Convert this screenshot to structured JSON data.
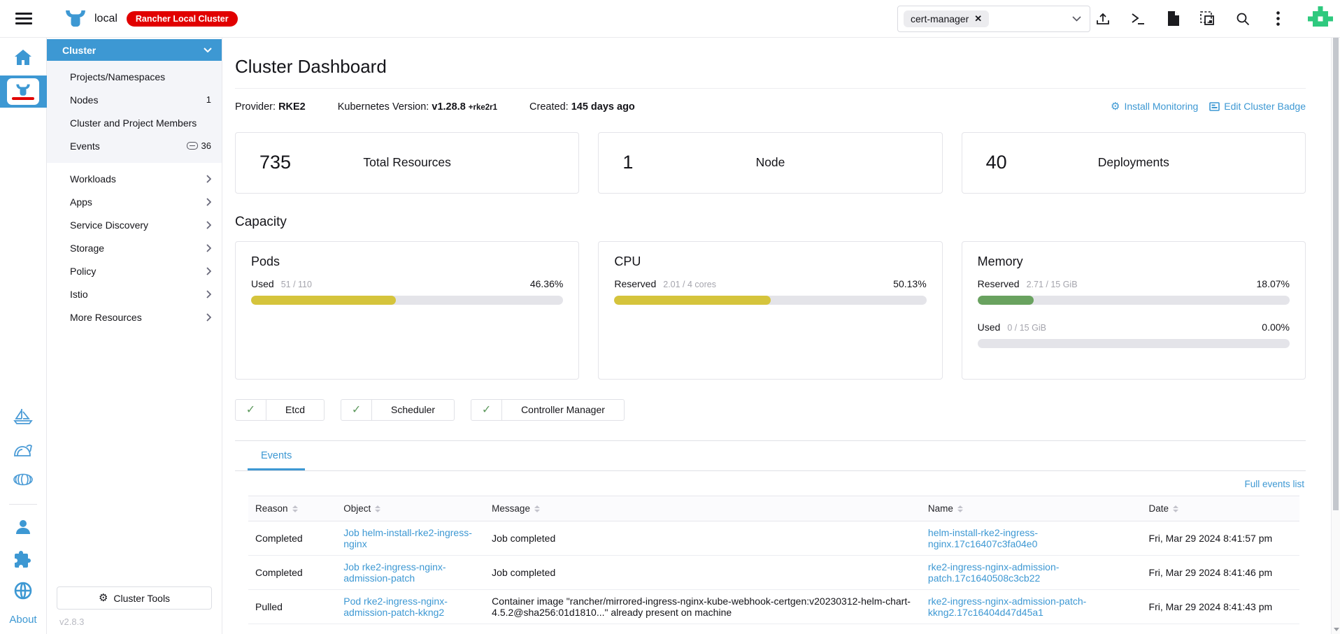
{
  "colors": {
    "primary": "#3d98d3",
    "badge_red": "#e10000",
    "bar_yellow": "#d5c43c",
    "bar_green": "#69a25f",
    "success_check": "#5d995d"
  },
  "topbar": {
    "cluster_name": "local",
    "cluster_badge": "Rancher Local Cluster",
    "namespace_filter": {
      "chip": "cert-manager",
      "remove_glyph": "✕"
    }
  },
  "rail": {
    "about_label": "About"
  },
  "sidebar": {
    "section_label": "Cluster",
    "items": [
      {
        "label": "Projects/Namespaces"
      },
      {
        "label": "Nodes",
        "count": "1"
      },
      {
        "label": "Cluster and Project Members"
      },
      {
        "label": "Events",
        "count": "36"
      },
      {
        "label": "Workloads"
      },
      {
        "label": "Apps"
      },
      {
        "label": "Service Discovery"
      },
      {
        "label": "Storage"
      },
      {
        "label": "Policy"
      },
      {
        "label": "Istio"
      },
      {
        "label": "More Resources"
      }
    ],
    "cluster_tools_label": "Cluster Tools",
    "gear_glyph": "⚙",
    "version": "v2.8.3"
  },
  "main": {
    "title": "Cluster Dashboard",
    "meta": {
      "provider_label": "Provider:",
      "provider_value": "RKE2",
      "k8s_label": "Kubernetes Version:",
      "k8s_value": "v1.28.8",
      "k8s_suffix": "+rke2r1",
      "created_label": "Created:",
      "created_value": "145 days ago"
    },
    "actions": [
      {
        "label": "Install Monitoring",
        "glyph": "⚙"
      },
      {
        "label": "Edit Cluster Badge"
      }
    ],
    "summary_cards": [
      {
        "value": "735",
        "label": "Total Resources"
      },
      {
        "value": "1",
        "label": "Node"
      },
      {
        "value": "40",
        "label": "Deployments"
      }
    ],
    "capacity_heading": "Capacity",
    "capacity_cards": [
      {
        "title": "Pods",
        "rows": [
          {
            "label": "Used",
            "detail": "51 / 110",
            "percent": "46.36%",
            "fill": 46.36,
            "color": "#d5c43c"
          }
        ]
      },
      {
        "title": "CPU",
        "rows": [
          {
            "label": "Reserved",
            "detail": "2.01 / 4 cores",
            "percent": "50.13%",
            "fill": 50.13,
            "color": "#d5c43c"
          }
        ]
      },
      {
        "title": "Memory",
        "rows": [
          {
            "label": "Reserved",
            "detail": "2.71 / 15 GiB",
            "percent": "18.07%",
            "fill": 18.07,
            "color": "#69a25f"
          },
          {
            "label": "Used",
            "detail": "0 / 15 GiB",
            "percent": "0.00%",
            "fill": 0,
            "color": "#69a25f"
          }
        ]
      }
    ],
    "status_badges": [
      {
        "check": "✓",
        "label": "Etcd"
      },
      {
        "check": "✓",
        "label": "Scheduler"
      },
      {
        "check": "✓",
        "label": "Controller Manager"
      }
    ],
    "events": {
      "tab_label": "Events",
      "full_list_label": "Full events list",
      "columns": [
        {
          "label": "Reason"
        },
        {
          "label": "Object"
        },
        {
          "label": "Message"
        },
        {
          "label": "Name"
        },
        {
          "label": "Date"
        }
      ],
      "rows": [
        {
          "reason": "Completed",
          "object": "Job helm-install-rke2-ingress-nginx",
          "message": "Job completed",
          "name": "helm-install-rke2-ingress-nginx.17c16407c3fa04e0",
          "date": "Fri, Mar 29 2024 8:41:57 pm"
        },
        {
          "reason": "Completed",
          "object": "Job rke2-ingress-nginx-admission-patch",
          "message": "Job completed",
          "name": "rke2-ingress-nginx-admission-patch.17c1640508c3cb22",
          "date": "Fri, Mar 29 2024 8:41:46 pm"
        },
        {
          "reason": "Pulled",
          "object": "Pod rke2-ingress-nginx-admission-patch-kkng2",
          "message": "Container image \"rancher/mirrored-ingress-nginx-kube-webhook-certgen:v20230312-helm-chart-4.5.2@sha256:01d1810...\" already present on machine",
          "name": "rke2-ingress-nginx-admission-patch-kkng2.17c16404d47d45a1",
          "date": "Fri, Mar 29 2024 8:41:43 pm"
        }
      ]
    }
  }
}
